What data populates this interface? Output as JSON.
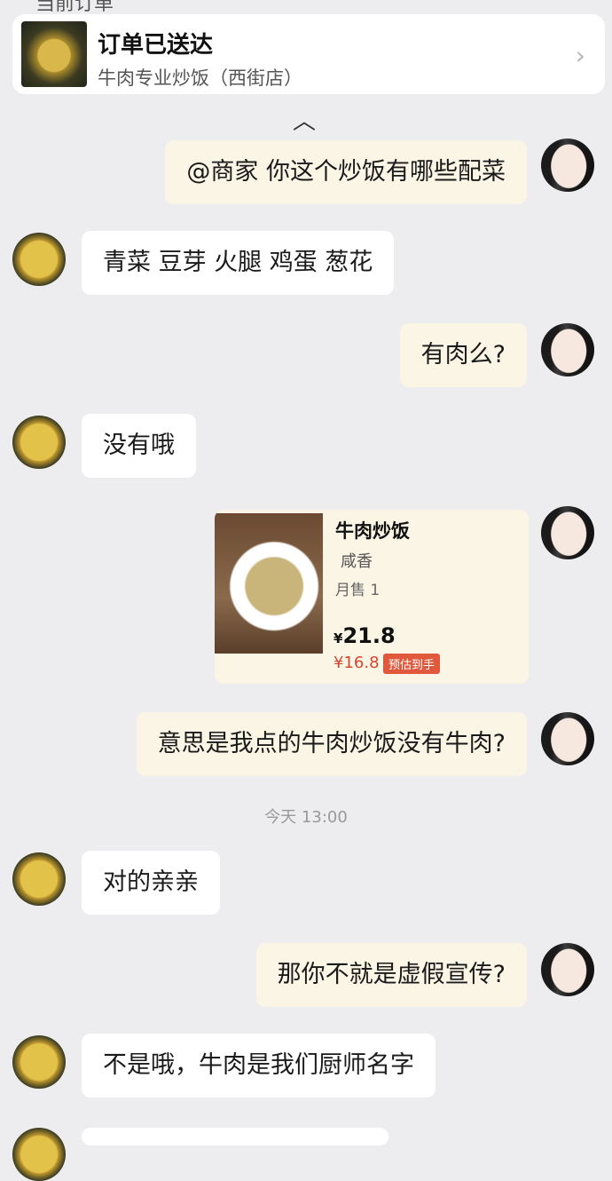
{
  "header": {
    "section_label": "当前订单",
    "order_status": "订单已送达",
    "shop_name": "牛肉专业炒饭（西街店）",
    "chevron_icon": "chevron-right-icon",
    "collapse_icon": "caret-up-icon"
  },
  "messages": [
    {
      "side": "out",
      "text": "@商家 你这个炒饭有哪些配菜"
    },
    {
      "side": "in",
      "text": "青菜 豆芽 火腿 鸡蛋 葱花"
    },
    {
      "side": "out",
      "text": "有肉么?"
    },
    {
      "side": "in",
      "text": "没有哦"
    },
    {
      "side": "out",
      "text": "意思是我点的牛肉炒饭没有牛肉?"
    },
    {
      "side": "in",
      "text": "对的亲亲"
    },
    {
      "side": "out",
      "text": "那你不就是虚假宣传?"
    },
    {
      "side": "in",
      "text": "不是哦，牛肉是我们厨师名字"
    }
  ],
  "product_card": {
    "name": "牛肉炒饭",
    "tag": "咸香",
    "sales": "月售 1",
    "price_symbol": "¥",
    "price": "21.8",
    "discount_price": "¥16.8",
    "discount_label": "预估到手"
  },
  "timestamp": "今天 13:00",
  "colors": {
    "background": "#ededef",
    "outgoing_bubble": "#fbf5e6",
    "incoming_bubble": "#ffffff",
    "discount_red": "#d6452e"
  }
}
